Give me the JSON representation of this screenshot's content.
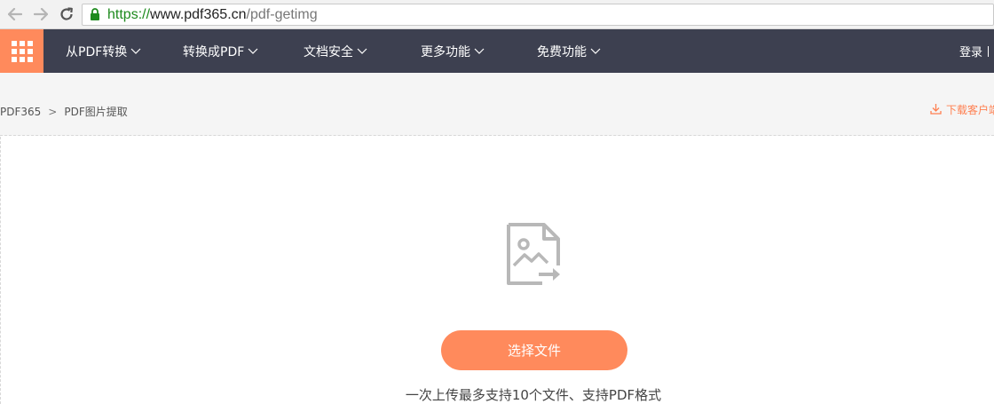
{
  "browser": {
    "url_scheme": "https://",
    "url_host": "www.pdf365.cn",
    "url_path": "/pdf-getimg"
  },
  "navbar": {
    "items": [
      {
        "label": "从PDF转换"
      },
      {
        "label": "转换成PDF"
      },
      {
        "label": "文档安全"
      },
      {
        "label": "更多功能"
      },
      {
        "label": "免费功能"
      }
    ],
    "login": "登录"
  },
  "breadcrumb": {
    "home": "PDF365",
    "separator": ">",
    "current": "PDF图片提取"
  },
  "download": {
    "label": "下载客户端"
  },
  "upload": {
    "button_label": "选择文件",
    "hint": "一次上传最多支持10个文件、支持PDF格式"
  },
  "colors": {
    "accent": "#ff8a5c",
    "navbar_bg": "#3d4050",
    "url_scheme": "#1d8a1d"
  },
  "icons": {
    "back": "back-arrow-icon",
    "forward": "forward-arrow-icon",
    "reload": "reload-icon",
    "lock": "lock-icon",
    "apps": "apps-grid-icon",
    "download": "download-icon",
    "file": "image-file-export-icon"
  }
}
